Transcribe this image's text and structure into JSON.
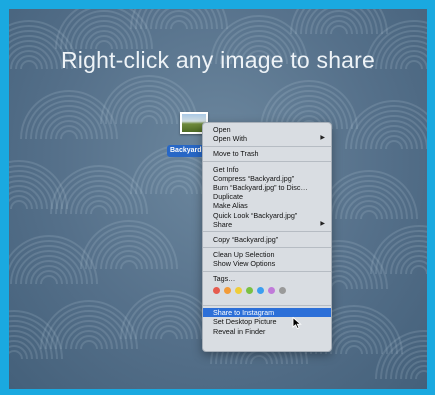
{
  "headline": "Right-click any image to share",
  "file": {
    "label": "Backyard.",
    "icon": "image-file-icon"
  },
  "menu": {
    "open": "Open",
    "open_with": "Open With",
    "move_to_trash": "Move to Trash",
    "get_info": "Get Info",
    "compress": "Compress “Backyard.jpg”",
    "burn": "Burn “Backyard.jpg” to Disc…",
    "duplicate": "Duplicate",
    "make_alias": "Make Alias",
    "quick_look": "Quick Look “Backyard.jpg”",
    "share": "Share",
    "copy": "Copy “Backyard.jpg”",
    "clean_up": "Clean Up Selection",
    "show_view_options": "Show View Options",
    "tags": "Tags…",
    "share_to_instagram": "Share to Instagram",
    "set_desktop_picture": "Set Desktop Picture",
    "reveal_in_finder": "Reveal in Finder",
    "submenu_arrow": "▶"
  },
  "tag_colors": [
    "#e55b4f",
    "#f29b39",
    "#efcd3a",
    "#7ac143",
    "#3c9ef0",
    "#c07ad9",
    "#9a9a9a"
  ],
  "colors": {
    "frame": "#1aa9e0",
    "highlight": "#2c6fd8",
    "selection_label": "#2767c6"
  }
}
